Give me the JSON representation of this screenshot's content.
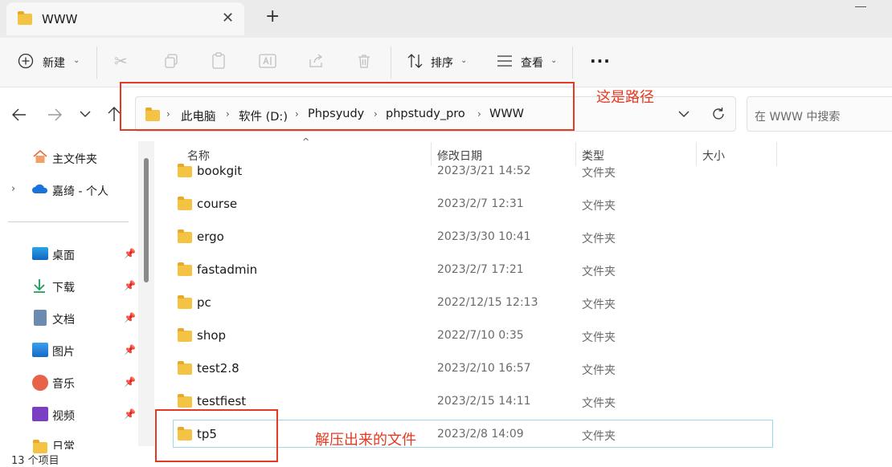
{
  "tab": {
    "title": "WWW",
    "close": "✕",
    "new_tab": "+"
  },
  "toolbar": {
    "new_label": "新建",
    "sort_label": "排序",
    "view_label": "查看",
    "more_label": "···"
  },
  "address": {
    "crumbs": [
      "此电脑",
      "软件 (D:)",
      "Phpsyudy",
      "phpstudy_pro",
      "WWW"
    ],
    "annotation": "这是路径"
  },
  "search": {
    "placeholder": "在 WWW 中搜索"
  },
  "sidebar": {
    "home": "主文件夹",
    "cloud": "嘉绮 - 个人",
    "pinned": [
      "桌面",
      "下载",
      "文档",
      "图片",
      "音乐",
      "视频",
      "日常"
    ]
  },
  "columns": {
    "name": "名称",
    "modified": "修改日期",
    "type": "类型",
    "size": "大小"
  },
  "files": [
    {
      "name": "bookgit",
      "modified": "2023/3/21 14:52",
      "type": "文件夹"
    },
    {
      "name": "course",
      "modified": "2023/2/7 12:31",
      "type": "文件夹"
    },
    {
      "name": "ergo",
      "modified": "2023/3/30 10:41",
      "type": "文件夹"
    },
    {
      "name": "fastadmin",
      "modified": "2023/2/7 17:21",
      "type": "文件夹"
    },
    {
      "name": "pc",
      "modified": "2022/12/15 12:13",
      "type": "文件夹"
    },
    {
      "name": "shop",
      "modified": "2022/7/10 0:35",
      "type": "文件夹"
    },
    {
      "name": "test2.8",
      "modified": "2023/2/10 16:57",
      "type": "文件夹"
    },
    {
      "name": "testfiest",
      "modified": "2023/2/15 14:11",
      "type": "文件夹"
    },
    {
      "name": "tp5",
      "modified": "2023/2/8 14:09",
      "type": "文件夹"
    }
  ],
  "file_annotation": "解压出来的文件",
  "status": {
    "count": "13 个项目"
  },
  "colors": {
    "annotation_red": "#e53a22",
    "folder_yellow": "#f5c343",
    "selection_border": "#9fd7ee"
  }
}
